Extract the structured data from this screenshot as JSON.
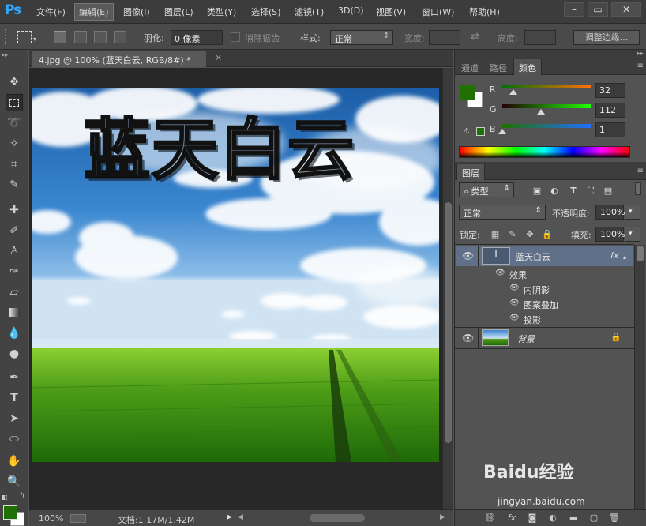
{
  "app": {
    "logo": "Ps"
  },
  "menu": [
    "文件(F)",
    "编辑(E)",
    "图像(I)",
    "图层(L)",
    "类型(Y)",
    "选择(S)",
    "滤镜(T)",
    "3D(D)",
    "视图(V)",
    "窗口(W)",
    "帮助(H)"
  ],
  "menu_active_index": 1,
  "window_controls": {
    "minimize": "–",
    "maximize": "▭",
    "close": "✕"
  },
  "options": {
    "feather_label": "羽化:",
    "feather_value": "0 像素",
    "antialias_label": "消除锯齿",
    "style_label": "样式:",
    "style_value": "正常",
    "width_label": "宽度:",
    "height_label": "高度:",
    "refine_button": "调整边缘..."
  },
  "document": {
    "tab_title": "4.jpg @ 100% (蓝天白云, RGB/8#) *",
    "close": "×",
    "canvas_text": "蓝天白云"
  },
  "status": {
    "zoom": "100%",
    "doc_info": "文档:1.17M/1.42M"
  },
  "panels": {
    "color_group_tabs": [
      "通道",
      "路径",
      "颜色"
    ],
    "color_active_tab": 2,
    "color": {
      "foreground": "#207004",
      "background": "#ffffff",
      "channels": [
        {
          "label": "R",
          "value": "32",
          "fraction": 0.125
        },
        {
          "label": "G",
          "value": "112",
          "fraction": 0.439
        },
        {
          "label": "B",
          "value": "1",
          "fraction": 0.004
        }
      ]
    },
    "layers_tab": "图层",
    "layers": {
      "filter_value": "类型",
      "blend_mode": "正常",
      "opacity_label": "不透明度:",
      "opacity_value": "100%",
      "lock_label": "锁定:",
      "fill_label": "填充:",
      "fill_value": "100%",
      "text_layer": {
        "thumb": "T",
        "name": "蓝天白云",
        "fx": "fx",
        "effects_label": "效果",
        "effects": [
          "内阴影",
          "图案叠加",
          "投影"
        ]
      },
      "background_layer": {
        "name": "背景"
      }
    }
  },
  "watermark": {
    "brand": "Baidu经验",
    "url": "jingyan.baidu.com"
  },
  "colors": {
    "accent_blue": "#31a8ff",
    "foreground_green": "#207004",
    "selected_layer": "#5f7088"
  }
}
